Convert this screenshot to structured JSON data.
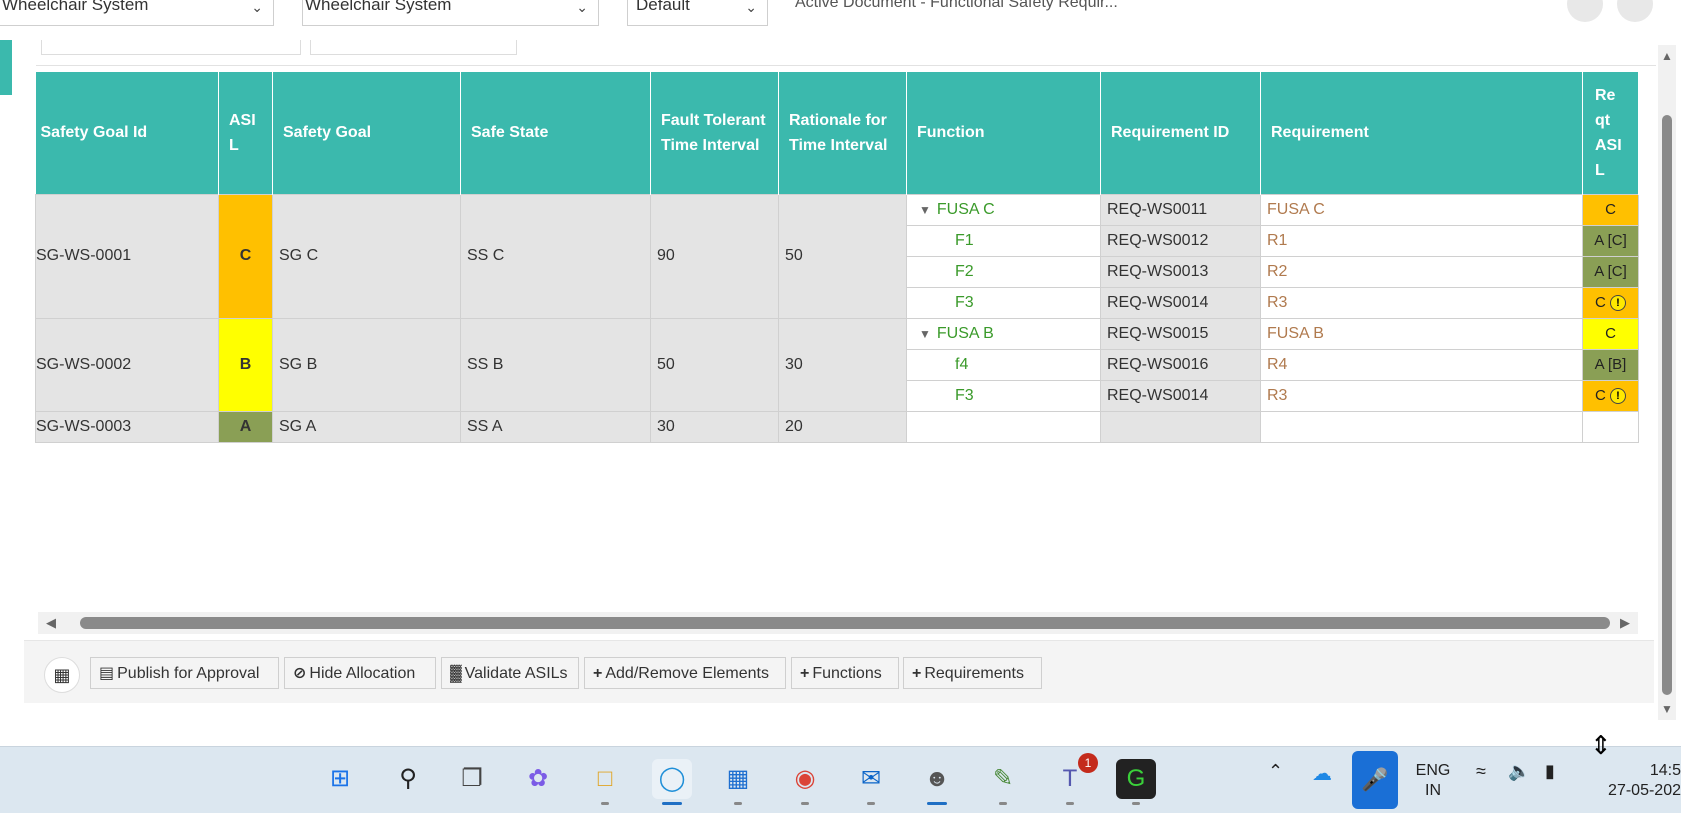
{
  "topbar": {
    "dropdown1": "Wheelchair System",
    "dropdown2": "Wheelchair System",
    "dropdown3": "Default",
    "active_document": "Active Document - Functional Safety Requir..."
  },
  "table": {
    "headers": {
      "safety_goal_id": "Safety Goal Id",
      "asil": "ASI L",
      "safety_goal": "Safety Goal",
      "safe_state": "Safe State",
      "ftti": "Fault Tolerant Time Interval",
      "rationale": "Rationale for Time Interval",
      "function": "Function",
      "requirement_id": "Requirement ID",
      "requirement": "Requirement",
      "reqt_asil": "Re qt ASI L"
    },
    "goals": [
      {
        "id": "SG-WS-0001",
        "asil": "C",
        "goal": "SG C",
        "state": "SS C",
        "ftti": "90",
        "rationale": "50"
      },
      {
        "id": "SG-WS-0002",
        "asil": "B",
        "goal": "SG B",
        "state": "SS B",
        "ftti": "50",
        "rationale": "30"
      },
      {
        "id": "SG-WS-0003",
        "asil": "A",
        "goal": "SG A",
        "state": "SS A",
        "ftti": "30",
        "rationale": "20"
      }
    ],
    "rows": [
      {
        "function": "FUSA C",
        "req_id": "REQ-WS0011",
        "requirement": "FUSA C",
        "req_asil": "C"
      },
      {
        "function": "F1",
        "req_id": "REQ-WS0012",
        "requirement": "R1",
        "req_asil": "A [C]"
      },
      {
        "function": "F2",
        "req_id": "REQ-WS0013",
        "requirement": "R2",
        "req_asil": "A [C]"
      },
      {
        "function": "F3",
        "req_id": "REQ-WS0014",
        "requirement": "R3",
        "req_asil": "C"
      },
      {
        "function": "FUSA B",
        "req_id": "REQ-WS0015",
        "requirement": "FUSA B",
        "req_asil": "C"
      },
      {
        "function": "f4",
        "req_id": "REQ-WS0016",
        "requirement": "R4",
        "req_asil": "A [B]"
      },
      {
        "function": "F3",
        "req_id": "REQ-WS0014",
        "requirement": "R3",
        "req_asil": "C"
      }
    ],
    "warn_glyph": "!",
    "colors": {
      "asil_c": "#ffc000",
      "asil_b": "#ffff00",
      "asil_a": "#8a9f55",
      "header": "#3bb9ad"
    }
  },
  "toolbar": {
    "publish": "Publish for Approval",
    "hide_allocation": "Hide Allocation",
    "validate": "Validate ASILs",
    "add_remove": "Add/Remove Elements",
    "functions": "Functions",
    "requirements": "Requirements"
  },
  "taskbar": {
    "lang1": "ENG",
    "lang2": "IN",
    "time": "14:5",
    "date": "27-05-202",
    "teams_badge": "1"
  }
}
